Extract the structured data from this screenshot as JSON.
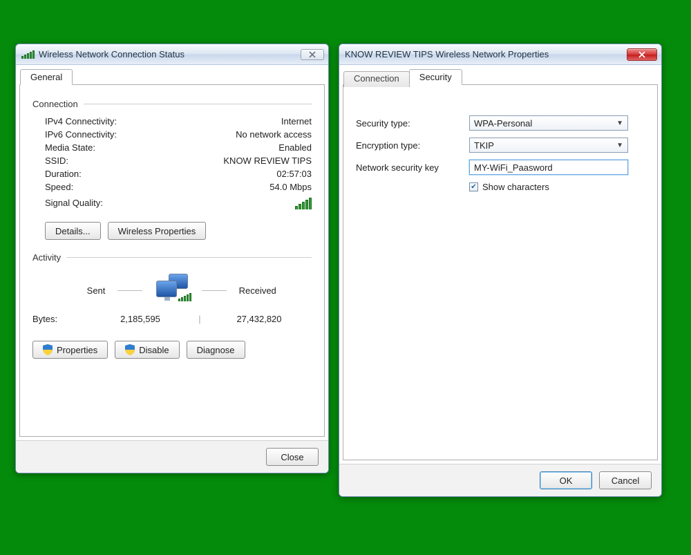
{
  "status": {
    "title": "Wireless Network Connection Status",
    "tab_general": "General",
    "group_connection": "Connection",
    "ipv4_label": "IPv4 Connectivity:",
    "ipv4_value": "Internet",
    "ipv6_label": "IPv6 Connectivity:",
    "ipv6_value": "No network access",
    "media_label": "Media State:",
    "media_value": "Enabled",
    "ssid_label": "SSID:",
    "ssid_value": "KNOW REVIEW TIPS",
    "duration_label": "Duration:",
    "duration_value": "02:57:03",
    "speed_label": "Speed:",
    "speed_value": "54.0 Mbps",
    "signal_label": "Signal Quality:",
    "btn_details": "Details...",
    "btn_wireless_props": "Wireless Properties",
    "group_activity": "Activity",
    "sent_label": "Sent",
    "received_label": "Received",
    "bytes_label": "Bytes:",
    "bytes_sent": "2,185,595",
    "bytes_received": "27,432,820",
    "btn_properties": "Properties",
    "btn_disable": "Disable",
    "btn_diagnose": "Diagnose",
    "btn_close": "Close"
  },
  "props": {
    "title": "KNOW REVIEW TIPS Wireless Network Properties",
    "tab_connection": "Connection",
    "tab_security": "Security",
    "security_type_label": "Security type:",
    "security_type_value": "WPA-Personal",
    "encryption_label": "Encryption type:",
    "encryption_value": "TKIP",
    "key_label": "Network security key",
    "key_value": "MY-WiFi_Paasword",
    "show_chars": "Show characters",
    "btn_ok": "OK",
    "btn_cancel": "Cancel"
  }
}
